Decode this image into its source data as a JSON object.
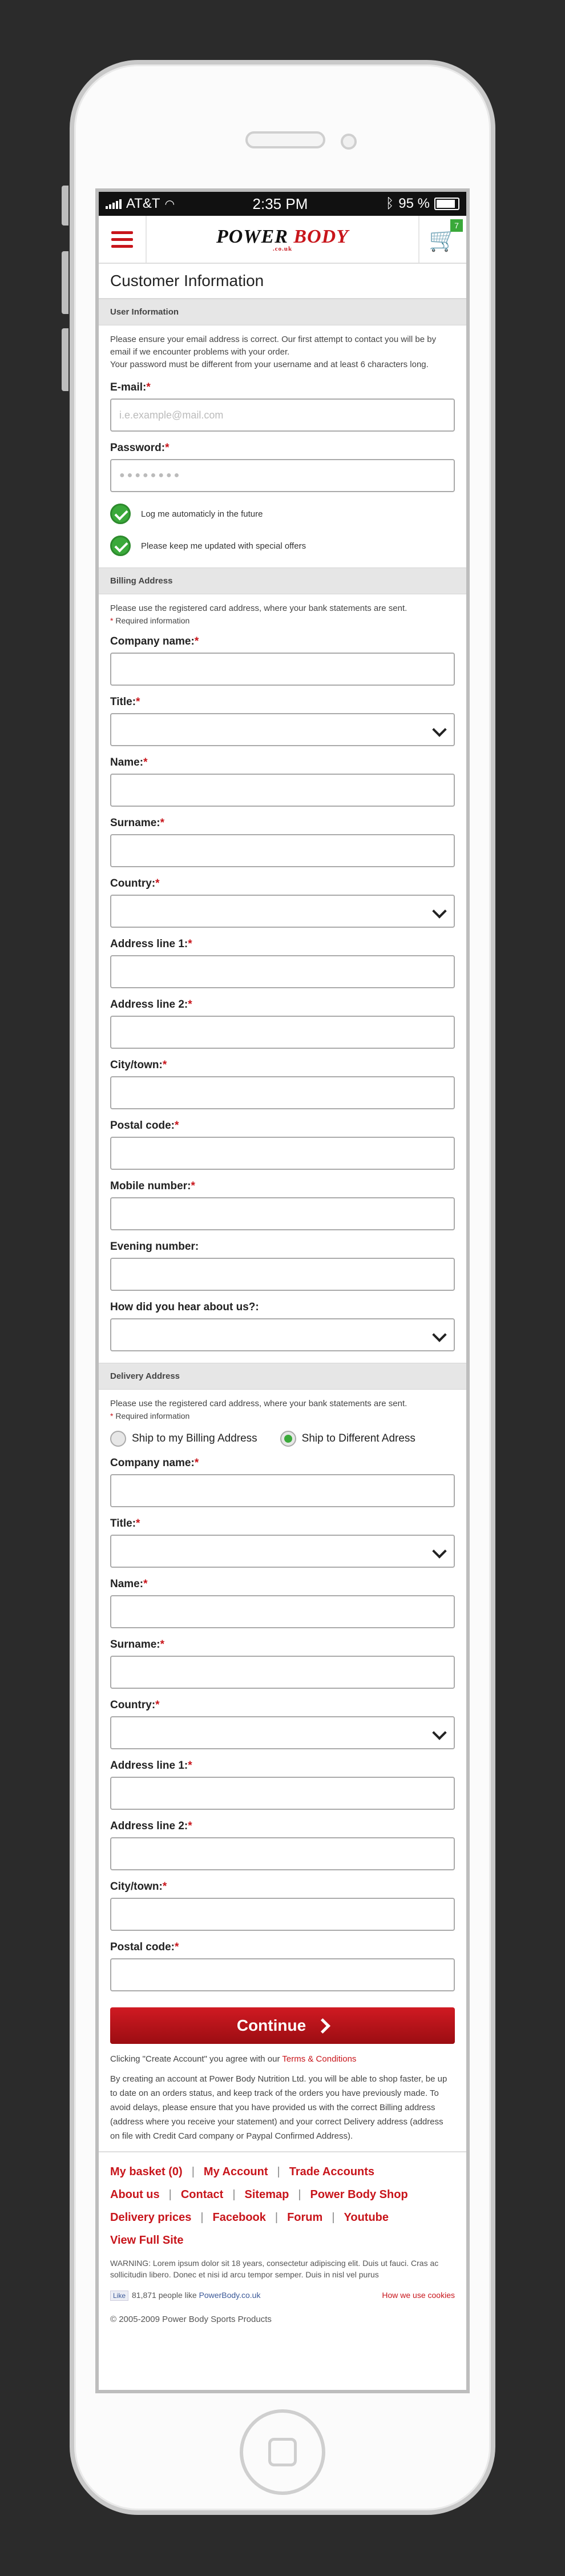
{
  "status": {
    "carrier": "AT&T",
    "time": "2:35 PM",
    "battery": "95 %"
  },
  "header": {
    "logo_left": "POWER",
    "logo_right": "BODY",
    "logo_sub": ".co.uk",
    "cart_count": "7"
  },
  "page_title": "Customer Information",
  "user_info": {
    "heading": "User Information",
    "note": "Please ensure your email address is correct. Our first attempt to contact you will be by email if we encounter problems with your order.",
    "note2": "Your password must be different from your username and at least 6 characters long.",
    "email_label": "E-mail:",
    "email_placeholder": "i.e.example@mail.com",
    "password_label": "Password:",
    "password_value": "●●●●●●●●",
    "check1": "Log me automaticly in the future",
    "check2": "Please keep me updated with special offers"
  },
  "billing": {
    "heading": "Billing Address",
    "note": "Please use the registered card address, where your bank statements are sent.",
    "required": "Required information",
    "fields": {
      "company": "Company name:",
      "title": "Title:",
      "name": "Name:",
      "surname": "Surname:",
      "country": "Country:",
      "addr1": "Address line 1:",
      "addr2": "Address line 2:",
      "city": "City/town:",
      "postal": "Postal code:",
      "mobile": "Mobile number:",
      "evening": "Evening number:",
      "hear": "How did you  hear about us?:"
    }
  },
  "delivery": {
    "heading": "Delivery Address",
    "note": "Please use the registered card address, where your bank statements are sent.",
    "required": "Required information",
    "radio1": "Ship to my Billing Address",
    "radio2": "Ship to Different Adress",
    "fields": {
      "company": "Company name:",
      "title": "Title:",
      "name": "Name:",
      "surname": "Surname:",
      "country": "Country:",
      "addr1": "Address line 1:",
      "addr2": "Address line 2:",
      "city": "City/town:",
      "postal": "Postal code:"
    }
  },
  "continue_label": "Continue",
  "terms": {
    "prefix": "Clicking \"Create Account\" you agree with our ",
    "link": "Terms & Conditions"
  },
  "info_text": "By creating an account at Power Body Nutrition Ltd. you will be able to shop faster, be up to date on an orders status, and keep track of the orders you have previously made. To avoid delays, please ensure that you have provided us with the correct Billing address (address where you receive your statement) and your correct Delivery address (address on file with Credit Card company or Paypal Confirmed Address).",
  "footer": {
    "row1": [
      "My basket (0)",
      "My Account",
      "Trade Accounts"
    ],
    "row2": [
      "About us",
      "Contact",
      "Sitemap",
      "Power Body Shop"
    ],
    "row3": [
      "Delivery prices",
      "Facebook",
      "Forum",
      "Youtube"
    ],
    "row4": [
      "View Full Site"
    ],
    "warning": "WARNING: Lorem ipsum dolor sit 18 years, consectetur adipiscing elit. Duis ut fauci. Cras ac sollicitudin libero. Donec et nisi id arcu tempor semper. Duis in nisl vel purus",
    "like": "Like",
    "like_text": "81,871 people like ",
    "like_link": "PowerBody.co.uk",
    "cookies": "How we use cookies",
    "copyright": "© 2005-2009 Power Body Sports Products"
  }
}
